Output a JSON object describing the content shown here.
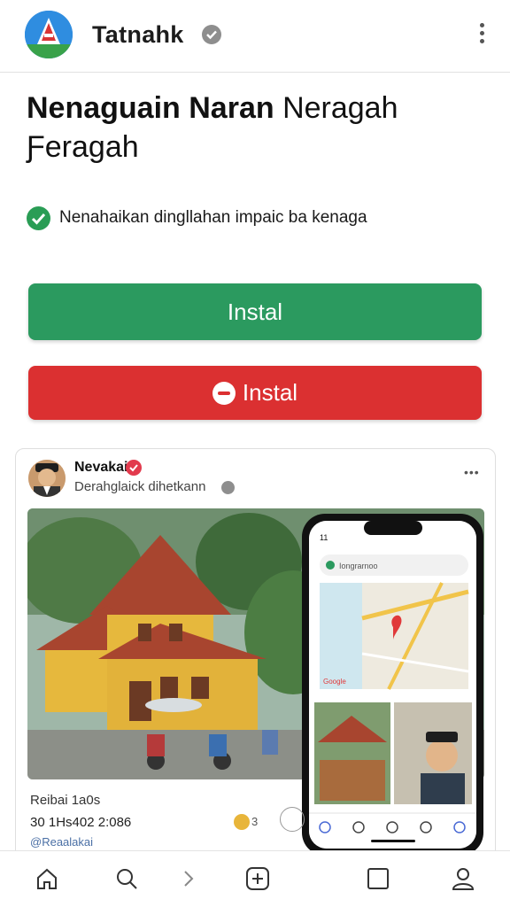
{
  "header": {
    "title": "Tatnahk",
    "logo_icon": "app-logo-icon",
    "verified_icon": "verified-icon",
    "menu_icon": "kebab-menu-icon"
  },
  "headline": {
    "line1_bold": "Nenaguain Naran",
    "line1_light": "Neragah",
    "line2": "Ƒeragah"
  },
  "feature": {
    "icon": "check-circle-icon",
    "text": "Nenahaikan dingllahan impaic ba kenaga"
  },
  "buttons": {
    "install_green": "Instal",
    "install_red": "Instal"
  },
  "post": {
    "name": "Nevakai",
    "subtitle": "Derahglaick dihetkann",
    "more": "•••",
    "caption_line1": "Reibai 1a0s",
    "caption_line2": "30 1Hs402 2:086",
    "caption_line3": "@Reaalakai",
    "reaction_count": "3"
  },
  "phone": {
    "search_text": "Iongrarnoo",
    "map_label": "Google"
  },
  "nav": [
    "home-icon",
    "search-icon",
    "chevron-right-icon",
    "plus-square-icon",
    "square-icon",
    "profile-icon"
  ],
  "colors": {
    "green": "#2b9a5f",
    "red": "#db3031"
  }
}
